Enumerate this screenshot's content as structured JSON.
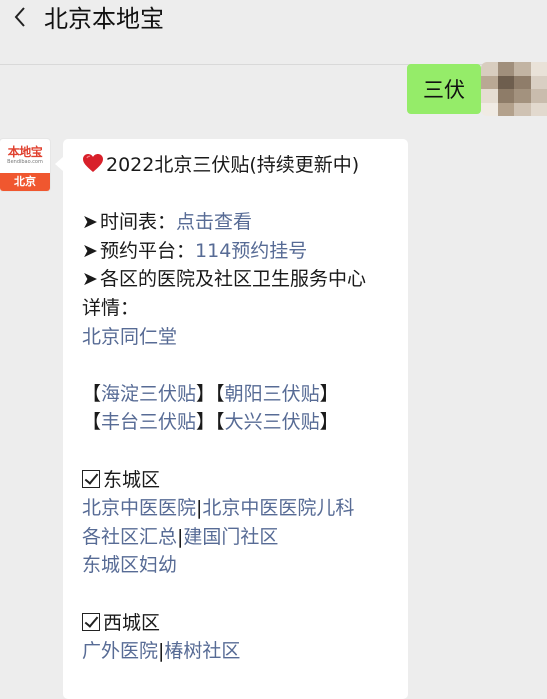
{
  "header": {
    "title": "北京本地宝",
    "back_icon": "chevron-left-icon"
  },
  "sent_message": {
    "text": "三伏"
  },
  "bot_avatar": {
    "logo_text": "本地宝",
    "logo_sub": "Bendibao.com",
    "city": "北京"
  },
  "message": {
    "heading": "2022北京三伏贴(持续更新中)",
    "schedule_prefix": "时间表：",
    "schedule_link": "点击查看",
    "booking_prefix": "预约平台：",
    "booking_link": "114预约挂号",
    "hospitals_line1": "各区的医院及社区卫生服务中心",
    "hospitals_line2": "详情：",
    "tongrentang": "北京同仁堂",
    "district_links": [
      {
        "open": "【",
        "label": "海淀三伏贴",
        "close": "】"
      },
      {
        "open": "【",
        "label": "朝阳三伏贴",
        "close": "】"
      },
      {
        "open": "【",
        "label": "丰台三伏贴",
        "close": "】"
      },
      {
        "open": "【",
        "label": "大兴三伏贴",
        "close": "】"
      }
    ],
    "dongcheng": {
      "title": "东城区",
      "links_row1": [
        "北京中医医院",
        "北京中医医院儿科"
      ],
      "links_row2": [
        "各社区汇总",
        "建国门社区"
      ],
      "links_row3": [
        "东城区妇幼"
      ],
      "separator": "|"
    },
    "xicheng": {
      "title": "西城区",
      "links_row1": [
        "广外医院",
        "椿树社区"
      ],
      "separator": "|"
    }
  },
  "colors": {
    "link": "#576b95",
    "sent_bubble": "#95ec69",
    "background": "#ededed"
  }
}
